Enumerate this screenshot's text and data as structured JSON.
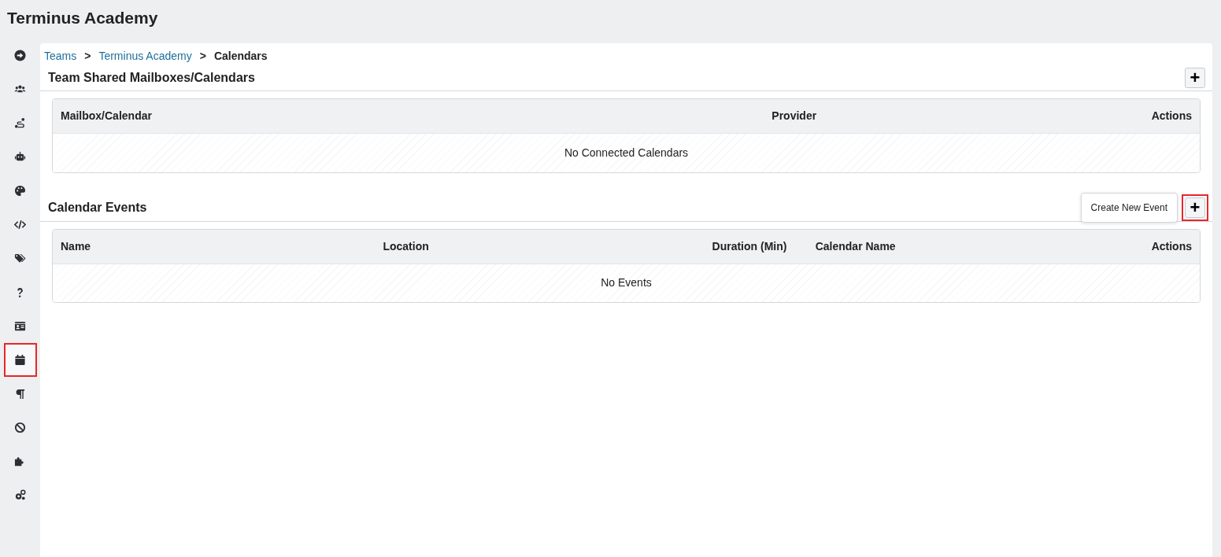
{
  "app_title": "Terminus Academy",
  "sidebar": {
    "items": [
      {
        "kind": "arrow-circle",
        "selected": false
      },
      {
        "kind": "users",
        "selected": false
      },
      {
        "kind": "route",
        "selected": false
      },
      {
        "kind": "robot",
        "selected": false
      },
      {
        "kind": "palette",
        "selected": false
      },
      {
        "kind": "code",
        "selected": false
      },
      {
        "kind": "tags",
        "selected": false
      },
      {
        "kind": "question",
        "selected": false
      },
      {
        "kind": "id-card",
        "selected": false
      },
      {
        "kind": "calendar",
        "selected": true
      },
      {
        "kind": "paragraph",
        "selected": false
      },
      {
        "kind": "ban",
        "selected": false
      },
      {
        "kind": "puzzle",
        "selected": false
      },
      {
        "kind": "cogs",
        "selected": false
      }
    ]
  },
  "breadcrumb": [
    {
      "label": "Teams",
      "link": true,
      "separator": ">"
    },
    {
      "label": "Terminus Academy",
      "link": true,
      "separator": ">"
    },
    {
      "label": "Calendars",
      "link": false
    }
  ],
  "sections": [
    {
      "title": "Team Shared Mailboxes/Calendars",
      "add_button": {
        "label": "+",
        "highlighted": false
      },
      "table": {
        "columns": [
          "Mailbox/Calendar",
          "Provider",
          "Actions"
        ],
        "empty_text": "No Connected Calendars"
      }
    },
    {
      "title": "Calendar Events",
      "add_button": {
        "label": "+",
        "highlighted": true,
        "tooltip": "Create New Event"
      },
      "table": {
        "columns": [
          "Name",
          "Location",
          "Duration (Min)",
          "Calendar Name",
          "Actions"
        ],
        "empty_text": "No Events"
      }
    }
  ]
}
